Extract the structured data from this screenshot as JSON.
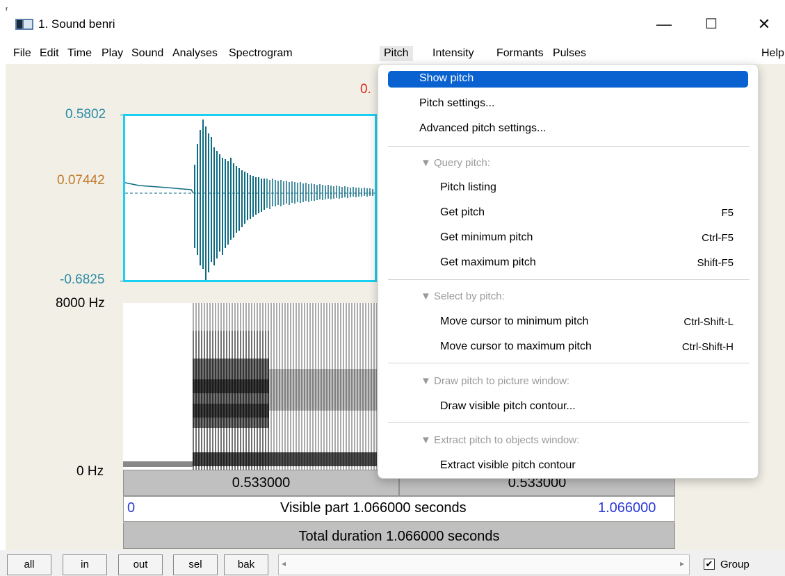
{
  "window": {
    "title": "1. Sound benri",
    "minimize": "—",
    "maximize": "☐",
    "close": "✕"
  },
  "menubar": {
    "items": [
      "File",
      "Edit",
      "Time",
      "Play",
      "Sound",
      "Analyses",
      "Spectrogram",
      "Pitch",
      "Intensity",
      "Formants",
      "Pulses"
    ],
    "help": "Help"
  },
  "editor": {
    "cursor_time_partial": "0.",
    "wave_max": "0.5802",
    "wave_mid": "0.07442",
    "wave_min": "-0.6825",
    "spec_max": "8000 Hz",
    "spec_min": "0 Hz",
    "left_half_time": "0.533000",
    "right_half_time": "0.533000",
    "visible_start": "0",
    "visible_label": "Visible part 1.066000 seconds",
    "visible_end": "1.066000",
    "total_label": "Total duration 1.066000 seconds"
  },
  "pitch_menu": {
    "show_pitch": "Show pitch",
    "pitch_settings": "Pitch settings...",
    "advanced_settings": "Advanced pitch settings...",
    "query_header": "▼ Query pitch:",
    "pitch_listing": "Pitch listing",
    "get_pitch": "Get pitch",
    "get_pitch_sc": "F5",
    "get_min": "Get minimum pitch",
    "get_min_sc": "Ctrl-F5",
    "get_max": "Get maximum pitch",
    "get_max_sc": "Shift-F5",
    "select_header": "▼ Select by pitch:",
    "move_min": "Move cursor to minimum pitch",
    "move_min_sc": "Ctrl-Shift-L",
    "move_max": "Move cursor to maximum pitch",
    "move_max_sc": "Ctrl-Shift-H",
    "draw_header": "▼ Draw pitch to picture window:",
    "draw_contour": "Draw visible pitch contour...",
    "extract_header": "▼ Extract pitch to objects window:",
    "extract_contour": "Extract visible pitch contour"
  },
  "toolbar": {
    "all": "all",
    "in": "in",
    "out": "out",
    "sel": "sel",
    "bak": "bak",
    "group": "Group",
    "group_checked": "✔"
  },
  "colors": {
    "wave": "#0d6b82",
    "cyan_border": "#1ad0f2",
    "teal_label": "#2a8aa6",
    "orange_label": "#c0782a",
    "red_cursor": "#e0261a",
    "blue_time": "#2a3ad6",
    "highlight": "#0a62d0"
  }
}
